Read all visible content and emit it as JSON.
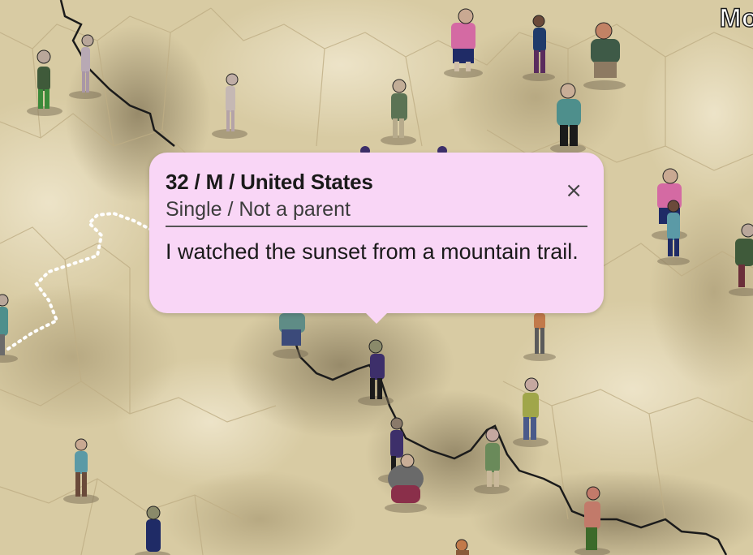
{
  "corner_label": "Mo",
  "tooltip": {
    "title": "32 / M / United States",
    "subtitle": "Single / Not a parent",
    "body": "I watched the sunset from a mountain trail.",
    "close_glyph": "×",
    "close_icon": "close-icon"
  },
  "colors": {
    "map_light": "#e6dab8",
    "map_mid": "#c9b98e",
    "map_dark": "#8f8265",
    "tooltip_bg": "#f9d6f6",
    "path_line": "#1b1b1b",
    "dotted_path": "#ffffff"
  }
}
